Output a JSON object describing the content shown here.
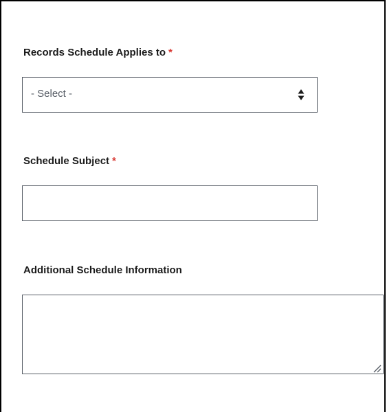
{
  "form": {
    "schedule_applies_to": {
      "label": "Records Schedule Applies to",
      "required_marker": "*",
      "selected_value": "- Select -"
    },
    "schedule_subject": {
      "label": "Schedule Subject",
      "required_marker": "*",
      "value": ""
    },
    "additional_info": {
      "label": "Additional Schedule Information",
      "value": ""
    }
  },
  "colors": {
    "required": "#d83933",
    "border": "#565c65",
    "label": "#1b1b1b"
  },
  "icons": {
    "select_arrows": "sort-arrows-icon",
    "resize": "resize-grip-icon"
  }
}
